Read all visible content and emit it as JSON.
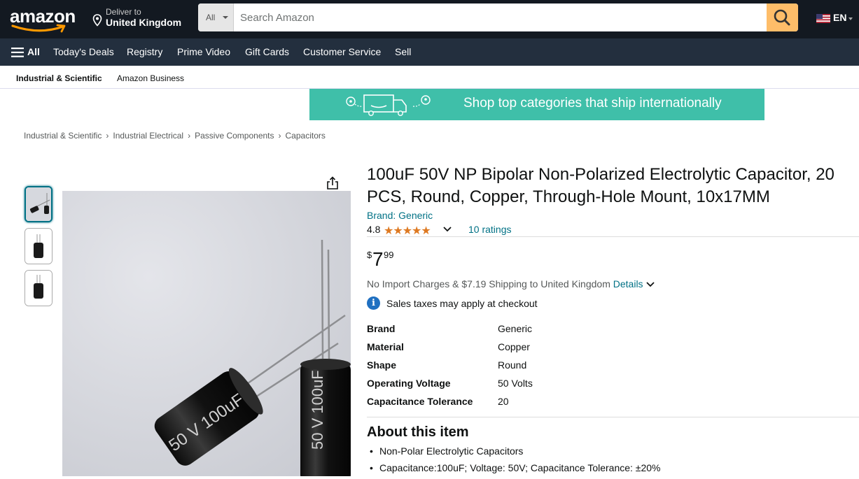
{
  "header": {
    "logo_text": "amazon",
    "deliver_label": "Deliver to",
    "deliver_location": "United Kingdom",
    "search_category": "All",
    "search_placeholder": "Search Amazon",
    "language": "EN"
  },
  "subnav": {
    "all_label": "All",
    "items": [
      "Today's Deals",
      "Registry",
      "Prime Video",
      "Gift Cards",
      "Customer Service",
      "Sell"
    ]
  },
  "catbar": {
    "items": [
      "Industrial & Scientific",
      "Amazon Business"
    ]
  },
  "banner": {
    "text": "Shop top categories that ship internationally"
  },
  "breadcrumb": [
    "Industrial & Scientific",
    "Industrial Electrical",
    "Passive Components",
    "Capacitors"
  ],
  "product": {
    "title": "100uF 50V NP Bipolar Non-Polarized Electrolytic Capacitor, 20 PCS, Round, Copper, Through-Hole Mount, 10x17MM",
    "brand": "Brand: Generic",
    "rating": "4.8",
    "stars": "★★★★★",
    "ratings_count": "10 ratings",
    "price_symbol": "$",
    "price_whole": "7",
    "price_fraction": "99",
    "shipping_text": "No Import Charges & $7.19 Shipping to United Kingdom",
    "shipping_link": "Details",
    "tax_text": "Sales taxes may apply at checkout",
    "specs": [
      {
        "key": "Brand",
        "value": "Generic"
      },
      {
        "key": "Material",
        "value": "Copper"
      },
      {
        "key": "Shape",
        "value": "Round"
      },
      {
        "key": "Operating Voltage",
        "value": "50 Volts"
      },
      {
        "key": "Capacitance Tolerance",
        "value": "20"
      }
    ],
    "about_heading": "About this item",
    "about_bullets": [
      "Non-Polar Electrolytic Capacitors",
      "Capacitance:100uF; Voltage: 50V; Capacitance Tolerance: ±20%"
    ]
  },
  "colors": {
    "nav_bg": "#131921",
    "subnav_bg": "#232f3e",
    "search_button": "#febd69",
    "banner_bg": "#3fbfa9",
    "link": "#007185",
    "star": "#de7921"
  }
}
